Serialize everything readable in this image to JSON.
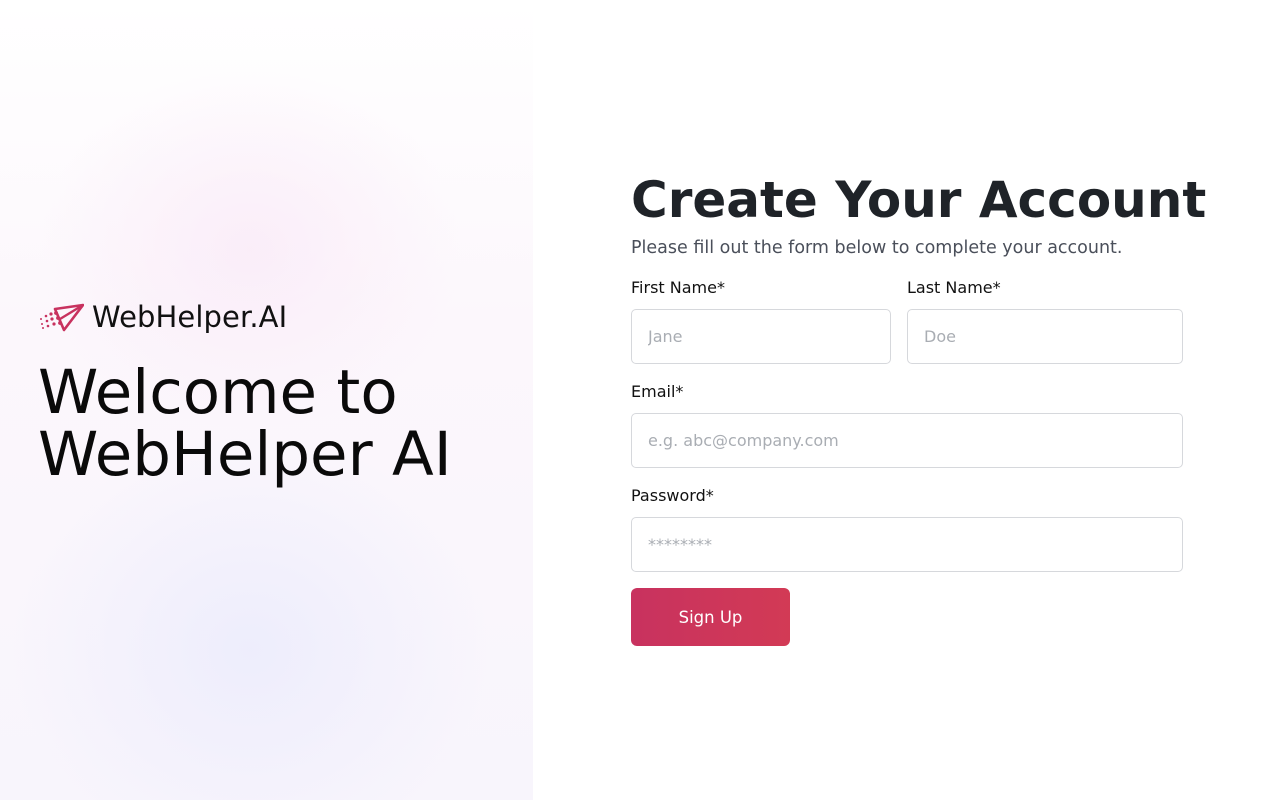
{
  "brand": {
    "name": "WebHelper.AI",
    "logo_icon": "paper-plane-dots-icon",
    "accent_color": "#c8325f"
  },
  "hero": {
    "welcome_line1": "Welcome to",
    "welcome_line2": "WebHelper AI"
  },
  "form": {
    "title": "Create Your Account",
    "subtitle": "Please fill out the form below to complete your account.",
    "first_name": {
      "label": "First Name*",
      "placeholder": "Jane",
      "value": ""
    },
    "last_name": {
      "label": "Last Name*",
      "placeholder": "Doe",
      "value": ""
    },
    "email": {
      "label": "Email*",
      "placeholder": "e.g. abc@company.com",
      "value": ""
    },
    "password": {
      "label": "Password*",
      "placeholder": "********",
      "value": ""
    },
    "submit_label": "Sign Up"
  }
}
